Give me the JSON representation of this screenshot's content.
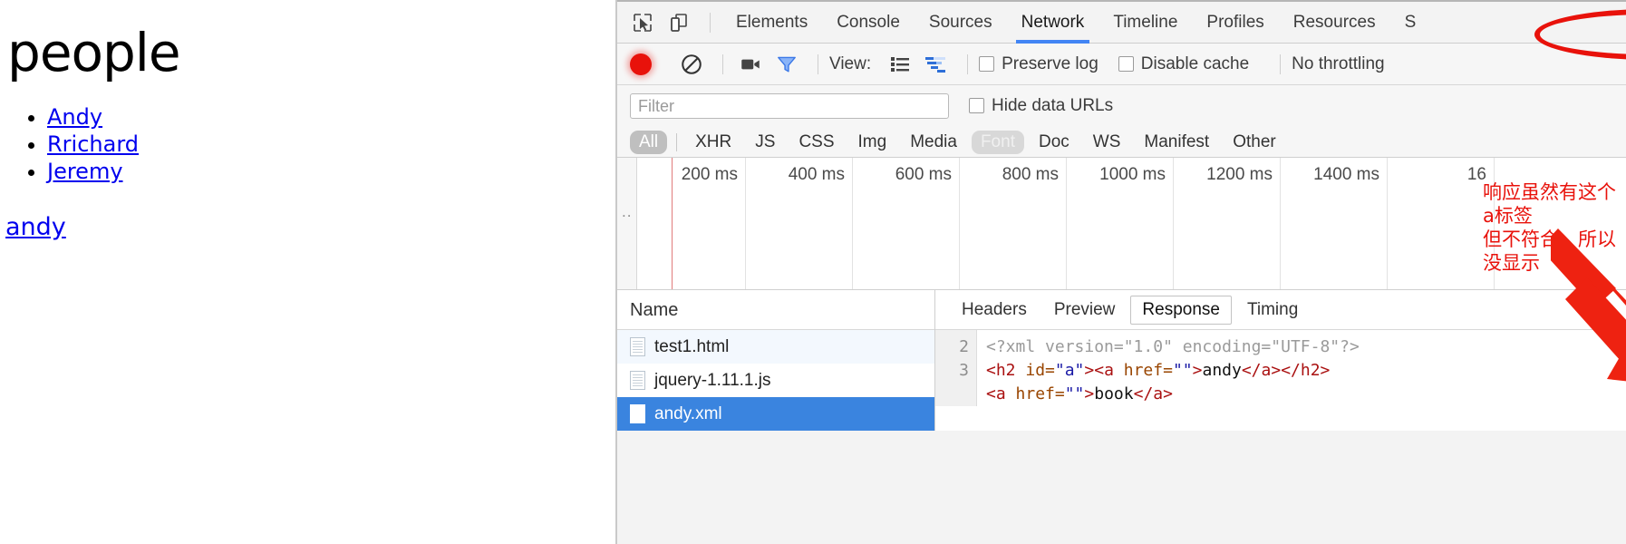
{
  "webpage": {
    "heading": "people",
    "people": [
      {
        "label": "Andy"
      },
      {
        "label": "Rrichard"
      },
      {
        "label": "Jeremy"
      }
    ],
    "bottom_link": "andy"
  },
  "devtools": {
    "icons": {
      "inspect": "cursor-select-icon",
      "device": "device-toggle-icon",
      "record": "record-icon",
      "clear": "clear-icon",
      "camera": "capture-screenshots-icon",
      "filter": "filter-funnel-icon",
      "list_view": "list-view-icon",
      "waterfall_view": "waterfall-view-icon"
    },
    "tabs": [
      {
        "label": "Elements",
        "active": false
      },
      {
        "label": "Console",
        "active": false
      },
      {
        "label": "Sources",
        "active": false
      },
      {
        "label": "Network",
        "active": true
      },
      {
        "label": "Timeline",
        "active": false
      },
      {
        "label": "Profiles",
        "active": false
      },
      {
        "label": "Resources",
        "active": false
      },
      {
        "label": "S",
        "active": false
      }
    ],
    "toolbar": {
      "view_label": "View:",
      "preserve_log": "Preserve log",
      "preserve_log_checked": false,
      "disable_cache": "Disable cache",
      "disable_cache_checked": false,
      "throttling": "No throttling"
    },
    "filter": {
      "placeholder": "Filter",
      "value": "",
      "hide_data_urls": "Hide data URLs",
      "hide_data_urls_checked": false
    },
    "type_filters": [
      {
        "label": "All",
        "state": "selected"
      },
      {
        "label": "XHR",
        "state": "normal"
      },
      {
        "label": "JS",
        "state": "normal"
      },
      {
        "label": "CSS",
        "state": "normal"
      },
      {
        "label": "Img",
        "state": "normal"
      },
      {
        "label": "Media",
        "state": "normal"
      },
      {
        "label": "Font",
        "state": "dim"
      },
      {
        "label": "Doc",
        "state": "normal"
      },
      {
        "label": "WS",
        "state": "normal"
      },
      {
        "label": "Manifest",
        "state": "normal"
      },
      {
        "label": "Other",
        "state": "normal"
      }
    ],
    "overview": {
      "gutter_marks": "..",
      "ticks": [
        "200 ms",
        "400 ms",
        "600 ms",
        "800 ms",
        "1000 ms",
        "1200 ms",
        "1400 ms",
        "16"
      ]
    },
    "requests": {
      "column_header": "Name",
      "rows": [
        {
          "name": "test1.html",
          "state": "highlighted"
        },
        {
          "name": "jquery-1.11.1.js",
          "state": "normal"
        },
        {
          "name": "andy.xml",
          "state": "selected"
        }
      ]
    },
    "detail": {
      "tabs": [
        {
          "label": "Headers",
          "active": false
        },
        {
          "label": "Preview",
          "active": false
        },
        {
          "label": "Response",
          "active": true
        },
        {
          "label": "Timing",
          "active": false
        }
      ],
      "line_numbers": [
        "",
        "2",
        "3"
      ],
      "code_lines": [
        {
          "segments": [
            {
              "t": "<?xml version=\"1.0\" encoding=\"UTF-8\"?>",
              "k": "decl"
            }
          ]
        },
        {
          "segments": [
            {
              "t": "<h2",
              "k": "tag"
            },
            {
              "t": " id=",
              "k": "attr"
            },
            {
              "t": "\"a\"",
              "k": "val"
            },
            {
              "t": ">",
              "k": "tag"
            },
            {
              "t": "<a",
              "k": "tag"
            },
            {
              "t": " href=",
              "k": "attr"
            },
            {
              "t": "\"\"",
              "k": "val"
            },
            {
              "t": ">",
              "k": "tag"
            },
            {
              "t": "andy",
              "k": "text"
            },
            {
              "t": "</a>",
              "k": "tag"
            },
            {
              "t": "</h2>",
              "k": "tag"
            }
          ]
        },
        {
          "segments": [
            {
              "t": "<a",
              "k": "tag"
            },
            {
              "t": " href=",
              "k": "attr"
            },
            {
              "t": "\"\"",
              "k": "val"
            },
            {
              "t": ">",
              "k": "tag"
            },
            {
              "t": "book",
              "k": "text"
            },
            {
              "t": "</a>",
              "k": "tag"
            }
          ]
        }
      ]
    }
  },
  "annotations": {
    "note_line1": "响应虽然有这个a标签",
    "note_line2": "但不符合，所以没显示",
    "color": "#e8120b"
  }
}
